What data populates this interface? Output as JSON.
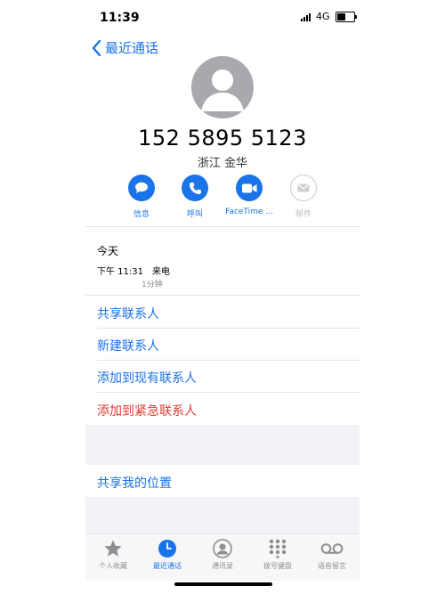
{
  "status": {
    "time": "11:39",
    "network": "4G"
  },
  "nav": {
    "back_label": "最近通话"
  },
  "contact": {
    "number": "152 5895 5123",
    "region": "浙江 金华"
  },
  "actions": [
    {
      "label": "信息",
      "icon": "message-icon",
      "enabled": true
    },
    {
      "label": "呼叫",
      "icon": "phone-icon",
      "enabled": true
    },
    {
      "label": "FaceTime ...",
      "icon": "video-icon",
      "enabled": true
    },
    {
      "label": "邮件",
      "icon": "mail-icon",
      "enabled": false
    }
  ],
  "history": {
    "heading": "今天",
    "time": "下午 11:31",
    "type": "来电",
    "duration": "1分钟"
  },
  "menu": {
    "share_contact": "共享联系人",
    "new_contact": "新建联系人",
    "add_existing": "添加到现有联系人",
    "add_emergency": "添加到紧急联系人",
    "share_location": "共享我的位置"
  },
  "tabs": [
    {
      "label": "个人收藏",
      "icon": "star-icon",
      "active": false
    },
    {
      "label": "最近通话",
      "icon": "clock-icon",
      "active": true
    },
    {
      "label": "通讯录",
      "icon": "contacts-icon",
      "active": false
    },
    {
      "label": "拨号键盘",
      "icon": "keypad-icon",
      "active": false
    },
    {
      "label": "语音留言",
      "icon": "voicemail-icon",
      "active": false
    }
  ],
  "colors": {
    "accent": "#1a73e8",
    "destructive": "#e03b31",
    "avatar": "#a7a9ae"
  }
}
